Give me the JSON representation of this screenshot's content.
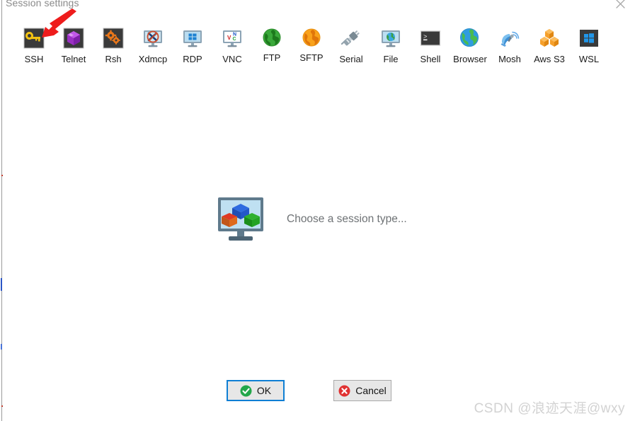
{
  "window": {
    "title": "Session settings",
    "close_icon": "close-icon"
  },
  "session_types": [
    {
      "label": "SSH",
      "icon": "ssh-key-icon"
    },
    {
      "label": "Telnet",
      "icon": "telnet-gem-icon"
    },
    {
      "label": "Rsh",
      "icon": "rsh-gears-icon"
    },
    {
      "label": "Xdmcp",
      "icon": "xdmcp-monitor-x-icon"
    },
    {
      "label": "RDP",
      "icon": "rdp-monitor-windows-icon"
    },
    {
      "label": "VNC",
      "icon": "vnc-monitor-icon"
    },
    {
      "label": "FTP",
      "icon": "ftp-green-globe-icon"
    },
    {
      "label": "SFTP",
      "icon": "sftp-orange-globe-icon"
    },
    {
      "label": "Serial",
      "icon": "serial-plug-icon"
    },
    {
      "label": "File",
      "icon": "file-monitor-globe-icon"
    },
    {
      "label": "Shell",
      "icon": "shell-terminal-icon"
    },
    {
      "label": "Browser",
      "icon": "browser-globe-icon"
    },
    {
      "label": "Mosh",
      "icon": "mosh-satellite-icon"
    },
    {
      "label": "Aws S3",
      "icon": "aws-s3-cubes-icon"
    },
    {
      "label": "WSL",
      "icon": "wsl-windows-icon"
    }
  ],
  "placeholder": {
    "icon": "monitor-cubes-icon",
    "text": "Choose a session type..."
  },
  "footer": {
    "ok_label": "OK",
    "ok_icon": "green-check-icon",
    "cancel_label": "Cancel",
    "cancel_icon": "red-x-icon"
  },
  "annotation": {
    "arrow_icon": "red-arrow-icon",
    "arrow_color": "#ee1c1c"
  },
  "watermark": {
    "text": "CSDN @浪迹天涯@wxy"
  },
  "colors": {
    "background": "#ffffff",
    "focus_border": "#0f7fd4",
    "button_face": "#e7e7e7",
    "title_text": "#8a8a8a",
    "placeholder_text": "#6e7275",
    "watermark": "#d2d2d2"
  }
}
